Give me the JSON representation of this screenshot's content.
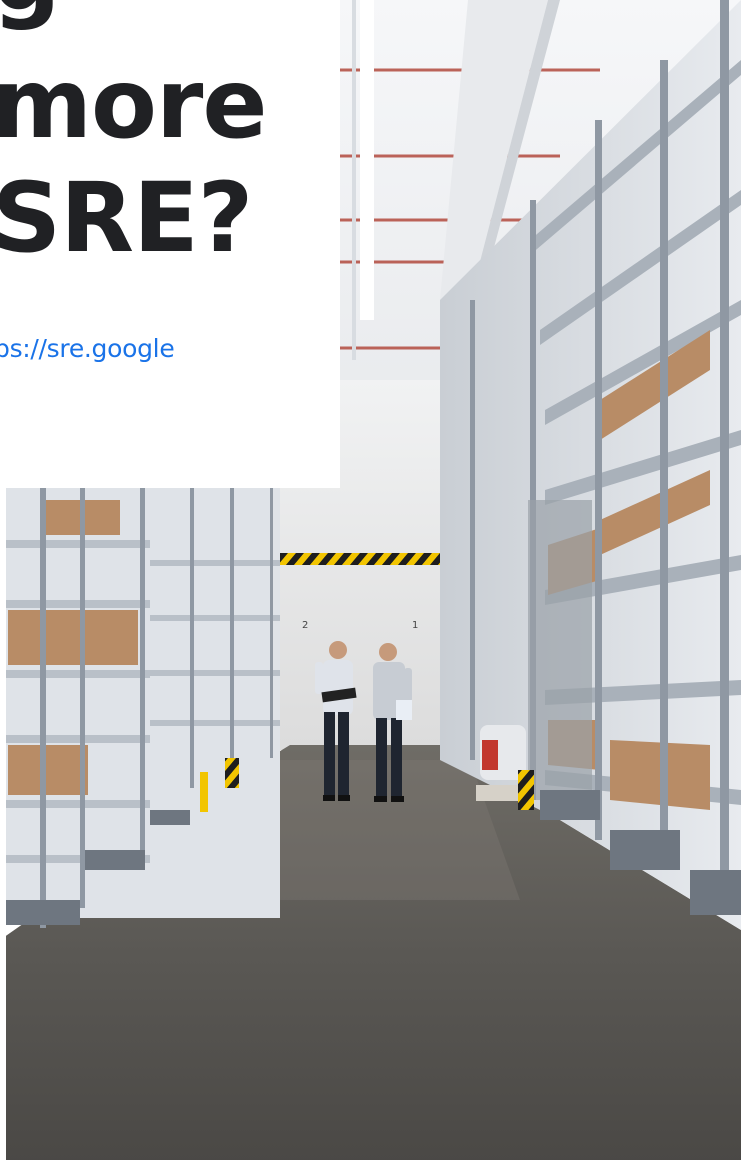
{
  "headline": {
    "line1": "g",
    "line2": "more",
    "line3": "SRE?"
  },
  "link": {
    "text": "ps://sre.google"
  },
  "colors": {
    "headline": "#202124",
    "link": "#1a73e8",
    "card": "#ffffff",
    "hazard_stripe_yellow": "#f2c500",
    "hazard_stripe_black": "#1e1e1e"
  },
  "photo": {
    "subject": "warehouse-aisle-two-people"
  }
}
